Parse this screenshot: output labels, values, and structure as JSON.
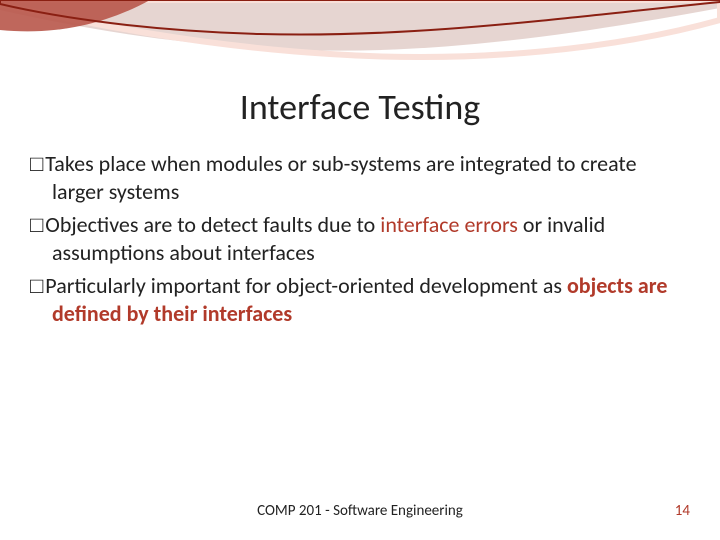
{
  "title": "Interface Testing",
  "bullets": [
    {
      "segments": [
        {
          "text": "Takes place when modules or sub-systems are integrated to create larger systems",
          "accent": false,
          "bold": false
        }
      ]
    },
    {
      "segments": [
        {
          "text": "Objectives are to detect faults due to ",
          "accent": false,
          "bold": false
        },
        {
          "text": "interface errors",
          "accent": true,
          "bold": false
        },
        {
          "text": " or invalid assumptions about interfaces",
          "accent": false,
          "bold": false
        }
      ]
    },
    {
      "segments": [
        {
          "text": "Particularly important for object-oriented development as ",
          "accent": false,
          "bold": false
        },
        {
          "text": "objects are defined by their interfaces",
          "accent": true,
          "bold": true
        }
      ]
    }
  ],
  "footer": {
    "center": "COMP 201 - Software Engineering",
    "page": "14"
  }
}
